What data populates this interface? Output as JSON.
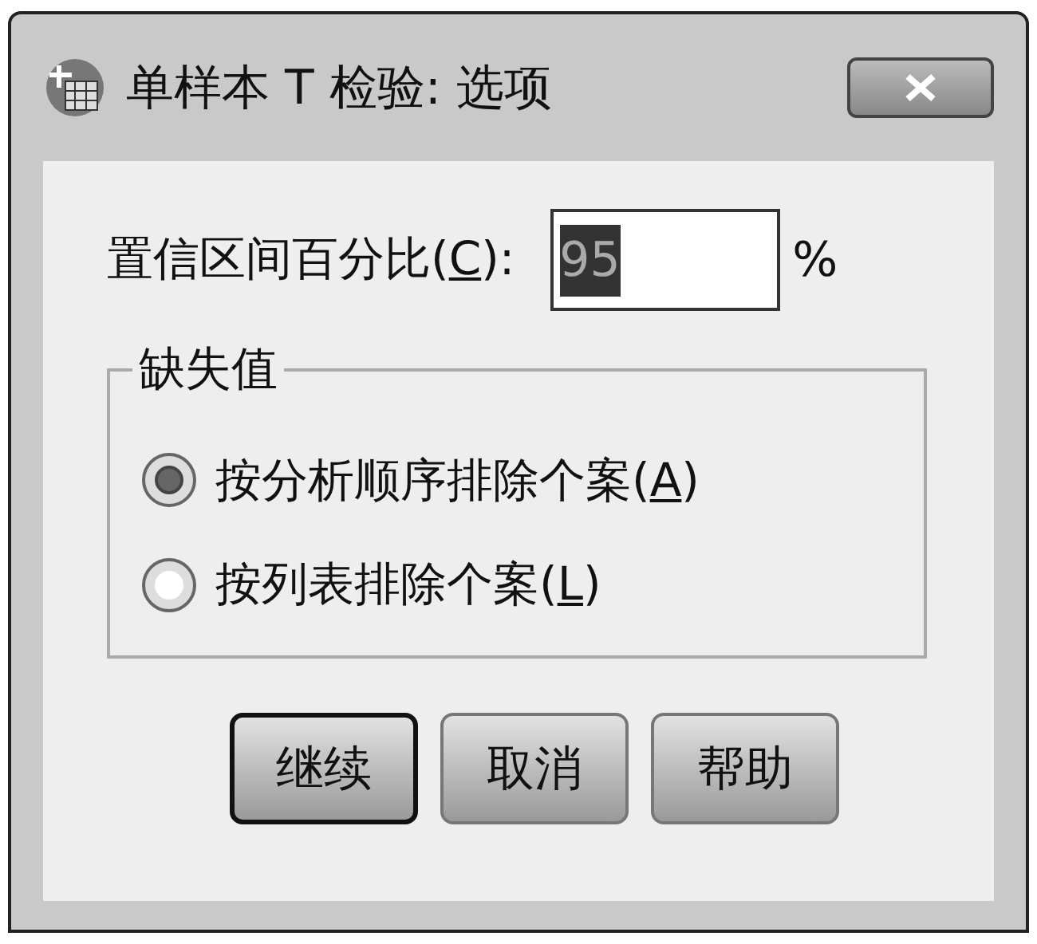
{
  "window": {
    "title": "单样本 T 检验: 选项"
  },
  "confidence": {
    "label": {
      "before": "置信区间百分比(",
      "key": "C",
      "after": "):"
    },
    "value": "95",
    "value_selected": true,
    "unit": "%"
  },
  "missing_values": {
    "title": "缺失值",
    "options": [
      {
        "label": {
          "before": "按分析顺序排除个案(",
          "key": "A",
          "after": ")"
        },
        "selected": true
      },
      {
        "label": {
          "before": "按列表排除个案(",
          "key": "L",
          "after": ")"
        },
        "selected": false
      }
    ]
  },
  "buttons": [
    {
      "label": "继续",
      "default": true
    },
    {
      "label": "取消",
      "default": false
    },
    {
      "label": "帮助",
      "default": false
    }
  ]
}
